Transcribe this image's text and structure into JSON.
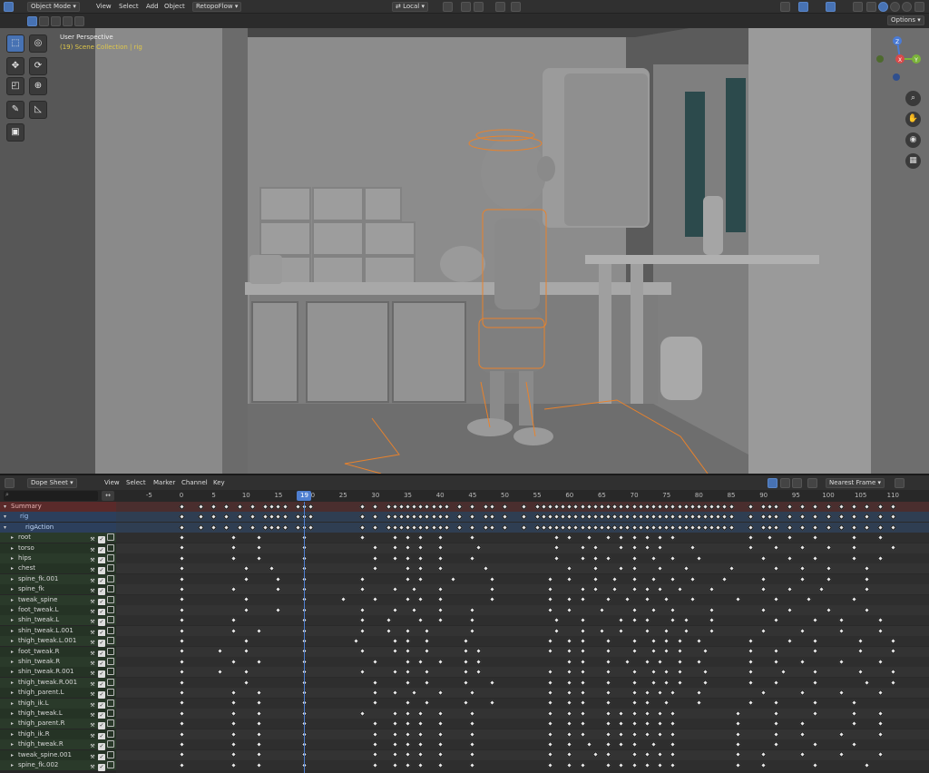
{
  "viewport_header": {
    "mode_label": "Object Mode",
    "menus": [
      "View",
      "Select",
      "Add",
      "Object"
    ],
    "addon_menu": "RetopoFlow",
    "transform_orientation": "Local",
    "options_label": "Options"
  },
  "viewport": {
    "perspective_label": "User Perspective",
    "collection_label": "(19) Scene Collection | rig",
    "gizmo_axes": {
      "z": "Z",
      "y": "Y",
      "x": "X"
    }
  },
  "dopesheet_header": {
    "editor_label": "Dope Sheet",
    "menus": [
      "View",
      "Select",
      "Marker",
      "Channel",
      "Key"
    ],
    "snap_label": "Nearest Frame"
  },
  "timeline": {
    "current_frame": "19",
    "ticks": [
      "-5",
      "0",
      "5",
      "10",
      "15",
      "20",
      "25",
      "30",
      "35",
      "40",
      "45",
      "50",
      "55",
      "60",
      "65",
      "70",
      "75",
      "80",
      "85",
      "90",
      "95",
      "100",
      "105",
      "110"
    ]
  },
  "channels": [
    {
      "label": "Summary",
      "kind": "summary"
    },
    {
      "label": "rig",
      "kind": "object"
    },
    {
      "label": "rigAction",
      "kind": "action"
    },
    {
      "label": "root",
      "kind": "bone"
    },
    {
      "label": "torso",
      "kind": "bone"
    },
    {
      "label": "hips",
      "kind": "bone"
    },
    {
      "label": "chest",
      "kind": "bone"
    },
    {
      "label": "spine_fk.001",
      "kind": "bone"
    },
    {
      "label": "spine_fk",
      "kind": "bone"
    },
    {
      "label": "tweak_spine",
      "kind": "bone"
    },
    {
      "label": "foot_tweak.L",
      "kind": "bone"
    },
    {
      "label": "shin_tweak.L",
      "kind": "bone"
    },
    {
      "label": "shin_tweak.L.001",
      "kind": "bone"
    },
    {
      "label": "thigh_tweak.L.001",
      "kind": "bone"
    },
    {
      "label": "foot_tweak.R",
      "kind": "bone"
    },
    {
      "label": "shin_tweak.R",
      "kind": "bone"
    },
    {
      "label": "shin_tweak.R.001",
      "kind": "bone"
    },
    {
      "label": "thigh_tweak.R.001",
      "kind": "bone"
    },
    {
      "label": "thigh_parent.L",
      "kind": "bone"
    },
    {
      "label": "thigh_ik.L",
      "kind": "bone"
    },
    {
      "label": "thigh_tweak.L",
      "kind": "bone"
    },
    {
      "label": "thigh_parent.R",
      "kind": "bone"
    },
    {
      "label": "thigh_ik.R",
      "kind": "bone"
    },
    {
      "label": "thigh_tweak.R",
      "kind": "bone"
    },
    {
      "label": "tweak_spine.001",
      "kind": "bone"
    },
    {
      "label": "spine_fk.002",
      "kind": "bone"
    }
  ],
  "keyframes": [
    [
      0,
      3,
      5,
      7,
      9,
      11,
      13,
      14,
      15,
      16,
      18,
      19,
      20,
      28,
      30,
      32,
      33,
      34,
      35,
      36,
      37,
      38,
      39,
      40,
      41,
      43,
      45,
      47,
      48,
      50,
      53,
      55,
      56,
      57,
      58,
      59,
      60,
      61,
      62,
      63,
      64,
      65,
      66,
      67,
      68,
      69,
      70,
      71,
      72,
      73,
      74,
      75,
      76,
      77,
      78,
      79,
      80,
      81,
      82,
      83,
      84,
      85,
      88,
      90,
      91,
      92,
      94,
      96,
      98,
      100,
      102,
      104,
      106,
      108,
      110
    ],
    [
      0,
      3,
      5,
      7,
      9,
      11,
      13,
      14,
      15,
      16,
      18,
      19,
      20,
      28,
      30,
      32,
      33,
      34,
      35,
      36,
      37,
      38,
      39,
      40,
      41,
      43,
      45,
      47,
      48,
      50,
      53,
      55,
      56,
      57,
      58,
      59,
      60,
      61,
      62,
      63,
      64,
      65,
      66,
      67,
      68,
      69,
      70,
      71,
      72,
      73,
      74,
      75,
      76,
      77,
      78,
      79,
      80,
      81,
      82,
      83,
      84,
      85,
      88,
      90,
      91,
      92,
      94,
      96,
      98,
      100,
      102,
      104,
      106,
      108,
      110
    ],
    [
      0,
      3,
      5,
      7,
      9,
      11,
      13,
      14,
      15,
      16,
      18,
      19,
      20,
      28,
      30,
      32,
      33,
      34,
      35,
      36,
      37,
      38,
      39,
      40,
      41,
      43,
      45,
      47,
      48,
      50,
      53,
      55,
      56,
      57,
      58,
      59,
      60,
      61,
      62,
      63,
      64,
      65,
      66,
      67,
      68,
      69,
      70,
      71,
      72,
      73,
      74,
      75,
      76,
      77,
      78,
      79,
      80,
      81,
      82,
      83,
      84,
      85,
      88,
      90,
      91,
      92,
      94,
      96,
      98,
      100,
      102,
      104,
      106,
      108,
      110
    ],
    [
      0,
      8,
      12,
      19,
      28,
      33,
      35,
      37,
      40,
      45,
      58,
      60,
      63,
      66,
      68,
      70,
      72,
      74,
      76,
      88,
      91,
      94,
      98,
      104,
      108
    ],
    [
      0,
      8,
      12,
      19,
      30,
      33,
      35,
      37,
      40,
      46,
      58,
      62,
      64,
      68,
      70,
      72,
      74,
      79,
      88,
      92,
      96,
      100,
      104,
      110
    ],
    [
      0,
      8,
      12,
      19,
      30,
      33,
      35,
      37,
      40,
      45,
      58,
      62,
      64,
      66,
      70,
      73,
      76,
      80,
      90,
      94,
      98,
      104,
      108
    ],
    [
      0,
      10,
      14,
      19,
      30,
      35,
      37,
      40,
      47,
      60,
      64,
      68,
      70,
      74,
      78,
      85,
      92,
      96,
      100,
      106
    ],
    [
      0,
      10,
      15,
      19,
      28,
      35,
      37,
      42,
      48,
      57,
      60,
      64,
      67,
      70,
      73,
      76,
      79,
      84,
      90,
      96,
      100,
      106
    ],
    [
      0,
      8,
      15,
      19,
      28,
      33,
      36,
      40,
      48,
      57,
      62,
      64,
      67,
      70,
      72,
      74,
      77,
      82,
      90,
      94,
      99,
      106
    ],
    [
      0,
      10,
      19,
      25,
      30,
      35,
      37,
      40,
      48,
      57,
      60,
      62,
      66,
      69,
      72,
      75,
      79,
      86,
      92,
      97,
      104
    ],
    [
      0,
      10,
      15,
      19,
      28,
      33,
      36,
      40,
      45,
      57,
      60,
      65,
      70,
      73,
      76,
      82,
      90,
      94,
      100,
      106
    ],
    [
      0,
      8,
      19,
      28,
      32,
      37,
      40,
      45,
      58,
      62,
      68,
      70,
      72,
      76,
      78,
      82,
      92,
      98,
      102,
      108
    ],
    [
      0,
      8,
      12,
      19,
      28,
      32,
      35,
      38,
      45,
      58,
      62,
      65,
      68,
      72,
      75,
      78,
      82,
      90,
      96,
      102,
      108
    ],
    [
      0,
      10,
      19,
      27,
      33,
      35,
      38,
      44,
      57,
      60,
      62,
      66,
      70,
      73,
      75,
      77,
      80,
      88,
      94,
      98,
      105,
      110
    ],
    [
      0,
      6,
      10,
      19,
      28,
      33,
      35,
      38,
      44,
      46,
      57,
      60,
      62,
      66,
      70,
      73,
      75,
      77,
      81,
      88,
      92,
      98,
      105,
      110
    ],
    [
      0,
      8,
      12,
      19,
      30,
      35,
      37,
      40,
      44,
      46,
      60,
      62,
      66,
      69,
      72,
      74,
      77,
      80,
      88,
      92,
      96,
      102,
      108
    ],
    [
      0,
      6,
      10,
      19,
      28,
      33,
      35,
      38,
      44,
      46,
      57,
      60,
      62,
      66,
      70,
      73,
      75,
      77,
      81,
      88,
      93,
      98,
      105,
      110
    ],
    [
      0,
      10,
      19,
      30,
      35,
      38,
      44,
      48,
      57,
      60,
      62,
      66,
      70,
      73,
      75,
      77,
      81,
      88,
      92,
      98,
      106,
      110
    ],
    [
      0,
      8,
      12,
      19,
      30,
      33,
      36,
      40,
      45,
      57,
      60,
      62,
      66,
      70,
      72,
      74,
      76,
      80,
      90,
      96,
      102,
      108
    ],
    [
      0,
      8,
      12,
      19,
      30,
      35,
      38,
      44,
      48,
      57,
      60,
      62,
      66,
      70,
      72,
      75,
      80,
      88,
      92,
      98,
      104
    ],
    [
      0,
      8,
      12,
      19,
      28,
      33,
      35,
      37,
      40,
      45,
      57,
      60,
      62,
      66,
      68,
      70,
      72,
      74,
      76,
      86,
      92,
      98,
      104,
      108
    ],
    [
      0,
      8,
      12,
      19,
      30,
      33,
      35,
      37,
      40,
      45,
      57,
      60,
      62,
      66,
      68,
      70,
      72,
      74,
      76,
      86,
      92,
      96,
      104,
      108
    ],
    [
      0,
      8,
      12,
      19,
      30,
      33,
      35,
      37,
      40,
      45,
      57,
      60,
      62,
      66,
      68,
      70,
      72,
      74,
      76,
      86,
      92,
      96,
      102,
      108
    ],
    [
      0,
      8,
      12,
      19,
      30,
      33,
      35,
      37,
      40,
      45,
      57,
      60,
      63,
      66,
      68,
      70,
      73,
      76,
      86,
      92,
      98,
      104
    ],
    [
      0,
      8,
      12,
      19,
      30,
      33,
      35,
      37,
      40,
      45,
      57,
      60,
      64,
      66,
      70,
      72,
      74,
      76,
      86,
      90,
      96,
      102,
      108
    ],
    [
      0,
      8,
      12,
      19,
      30,
      33,
      35,
      37,
      40,
      45,
      57,
      60,
      62,
      66,
      68,
      70,
      72,
      74,
      76,
      86,
      90,
      98,
      106
    ]
  ],
  "colors": {
    "accent": "#4772b3",
    "selection_orange": "#e8822c",
    "summary_row": "#5a2a2a",
    "object_row": "#2c3f5c",
    "bone_row": "#253325",
    "playhead": "#4f7fd0"
  },
  "icons": [
    "select-box-icon",
    "cursor-icon",
    "move-icon",
    "rotate-icon",
    "scale-icon",
    "transform-icon",
    "annotate-icon",
    "measure-icon",
    "add-cube-icon",
    "zoom-icon",
    "hand-icon",
    "camera-icon",
    "grid-icon",
    "wrench-icon",
    "checkbox-icon",
    "lock-icon",
    "filter-icon"
  ]
}
